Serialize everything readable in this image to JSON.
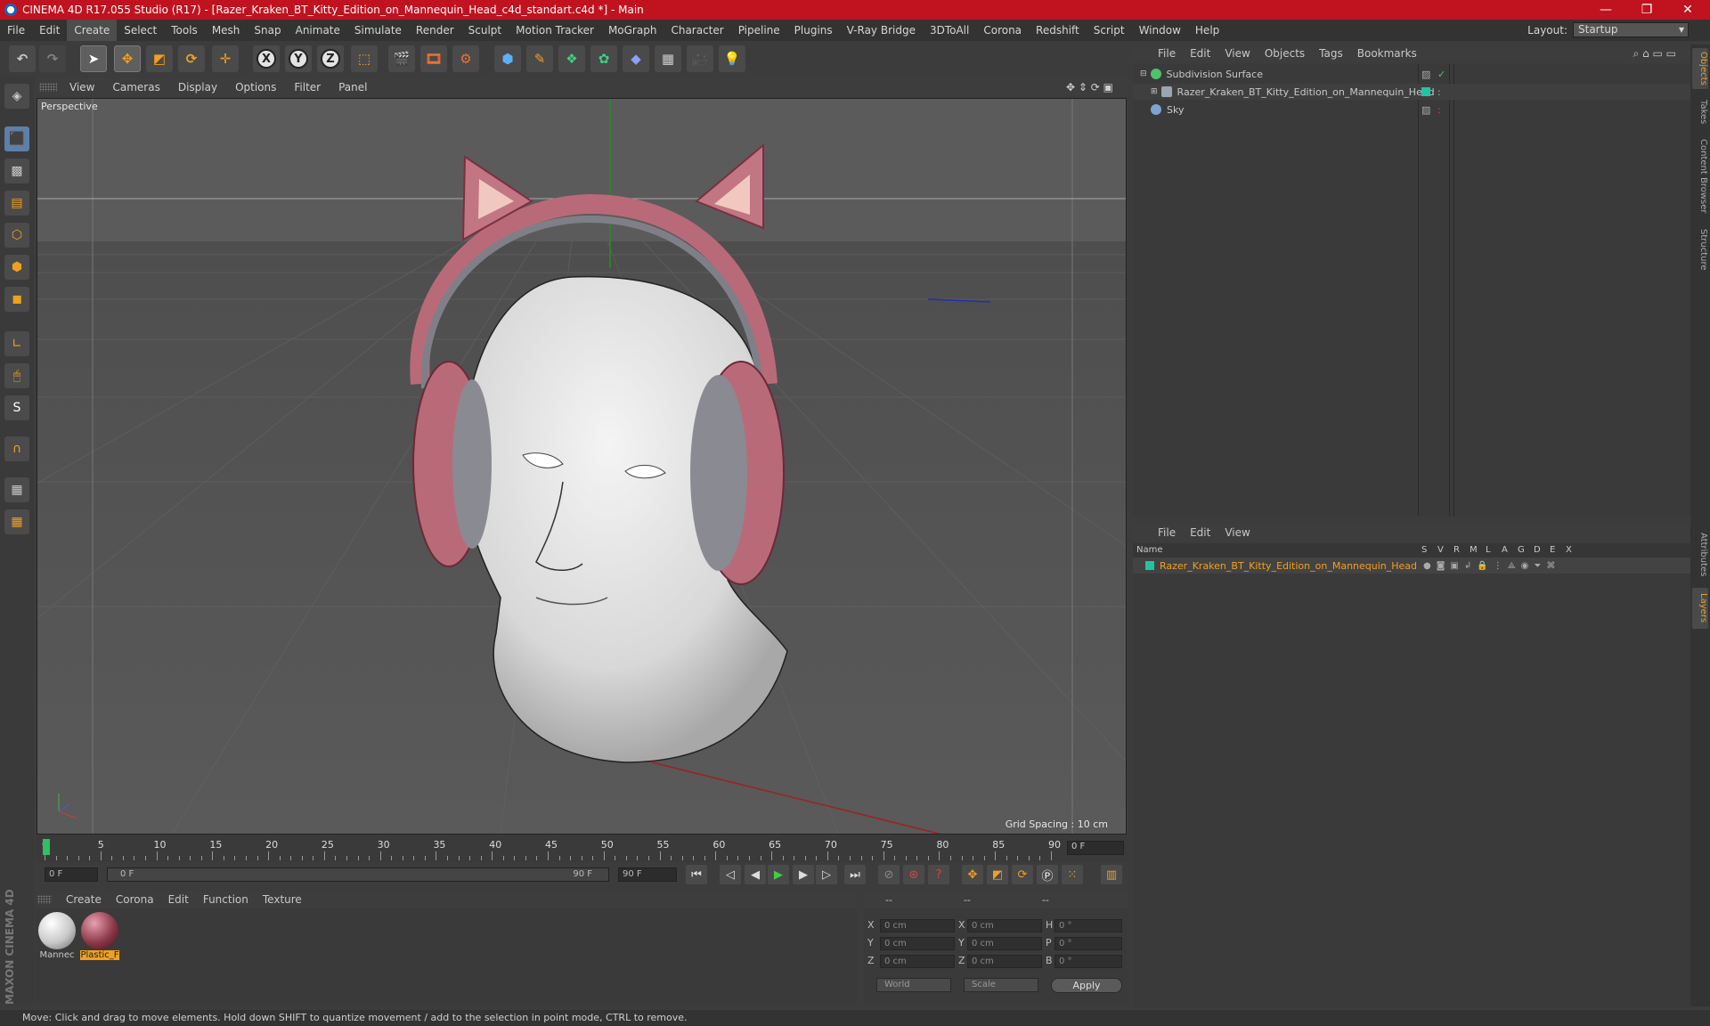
{
  "titlebar": {
    "title": "CINEMA 4D R17.055 Studio (R17) - [Razer_Kraken_BT_Kitty_Edition_on_Mannequin_Head_c4d_standart.c4d *] - Main",
    "minimize": "—",
    "restore": "❐",
    "close": "✕"
  },
  "menubar": {
    "items": [
      "File",
      "Edit",
      "Create",
      "Select",
      "Tools",
      "Mesh",
      "Snap",
      "Animate",
      "Simulate",
      "Render",
      "Sculpt",
      "Motion Tracker",
      "MoGraph",
      "Character",
      "Pipeline",
      "Plugins",
      "V-Ray Bridge",
      "3DToAll",
      "Corona",
      "Redshift",
      "Script",
      "Window",
      "Help"
    ],
    "layout_label": "Layout:",
    "layout_value": "Startup"
  },
  "toolbar": {
    "axis_x": "X",
    "axis_y": "Y",
    "axis_z": "Z"
  },
  "viewport": {
    "menu": [
      "View",
      "Cameras",
      "Display",
      "Options",
      "Filter",
      "Panel"
    ],
    "label": "Perspective",
    "grid_spacing": "Grid Spacing : 10 cm",
    "accent_headphone": "#b96a78"
  },
  "timeline": {
    "ticks": [
      "0",
      "5",
      "10",
      "15",
      "20",
      "25",
      "30",
      "35",
      "40",
      "45",
      "50",
      "55",
      "60",
      "65",
      "70",
      "75",
      "80",
      "85",
      "90"
    ],
    "current_frame": "0 F",
    "start_field": "0 F",
    "range_start": "0 F",
    "range_end": "90 F",
    "end_field": "90 F"
  },
  "materials": {
    "menu": [
      "Create",
      "Corona",
      "Edit",
      "Function",
      "Texture"
    ],
    "items": [
      {
        "label": "Mannec",
        "color": "#e8e8e8",
        "selected": false
      },
      {
        "label": "Plastic_F",
        "color": "#8c3848",
        "selected": true
      }
    ]
  },
  "coordinates": {
    "header": [
      "--",
      "--",
      "--"
    ],
    "rows": [
      {
        "a": "X",
        "av": "0 cm",
        "b": "X",
        "bv": "0 cm",
        "c": "H",
        "cv": "0 °"
      },
      {
        "a": "Y",
        "av": "0 cm",
        "b": "Y",
        "bv": "0 cm",
        "c": "P",
        "cv": "0 °"
      },
      {
        "a": "Z",
        "av": "0 cm",
        "b": "Z",
        "bv": "0 cm",
        "c": "B",
        "cv": "0 °"
      }
    ],
    "mode": "World",
    "type": "Scale",
    "apply": "Apply"
  },
  "object_manager": {
    "menu": [
      "File",
      "Edit",
      "View",
      "Objects",
      "Tags",
      "Bookmarks"
    ],
    "objects": [
      {
        "name": "Subdivision Surface",
        "color": "#4fc16b"
      },
      {
        "name": "Razer_Kraken_BT_Kitty_Edition_on_Mannequin_Head",
        "color": "#9aa6b4"
      },
      {
        "name": "Sky",
        "color": "#7fa3d0"
      }
    ]
  },
  "layer_manager": {
    "menu": [
      "File",
      "Edit",
      "View"
    ],
    "columns": [
      "Name",
      "S",
      "V",
      "R",
      "M",
      "L",
      "A",
      "G",
      "D",
      "E",
      "X"
    ],
    "layers": [
      {
        "name": "Razer_Kraken_BT_Kitty_Edition_on_Mannequin_Head",
        "color": "#1fc6a0"
      }
    ]
  },
  "sidetabs": [
    "Objects",
    "Takes",
    "Content Browser",
    "Structure",
    "Attributes",
    "Layers"
  ],
  "status": "Move: Click and drag to move elements. Hold down SHIFT to quantize movement / add to the selection in point mode, CTRL to remove.",
  "branding": "MAXON CINEMA 4D"
}
